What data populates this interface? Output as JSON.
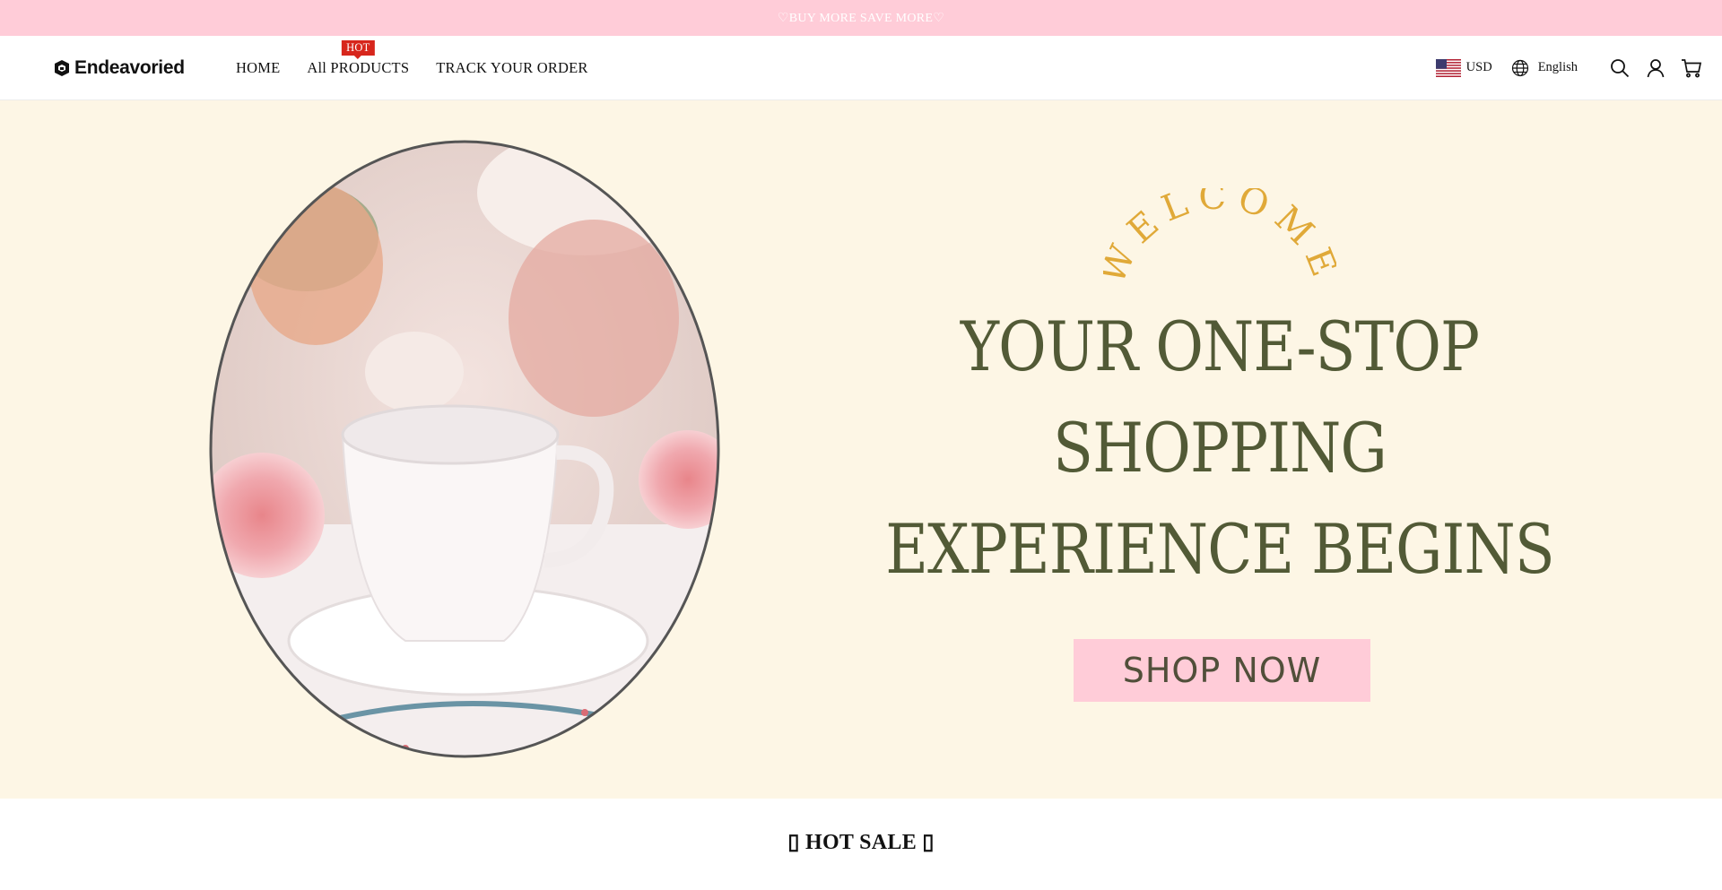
{
  "announcement": {
    "text": "♡BUY MORE SAVE MORE♡"
  },
  "brand": {
    "name": "Endeavoried"
  },
  "nav": {
    "items": [
      {
        "label": "HOME"
      },
      {
        "label": "All PRODUCTS",
        "badge": "HOT"
      },
      {
        "label": "TRACK YOUR ORDER"
      }
    ]
  },
  "toolbar": {
    "currency": "USD",
    "language": "English",
    "icons": [
      "us-flag-icon",
      "globe-icon",
      "search-icon",
      "account-icon",
      "cart-icon"
    ]
  },
  "hero": {
    "welcome": "WELCOME",
    "headline": [
      "YOUR ONE-STOP",
      "SHOPPING",
      "EXPERIENCE BEGINS"
    ],
    "button": "SHOP NOW"
  },
  "section": {
    "title": "▯ HOT SALE ▯"
  },
  "colors": {
    "announcement_bg": "#ffccd8",
    "hero_bg": "#fdf6e5",
    "headline": "#525a36",
    "welcome": "#e0a938",
    "button_bg": "#ffccd8",
    "badge_bg": "#d7261c"
  }
}
